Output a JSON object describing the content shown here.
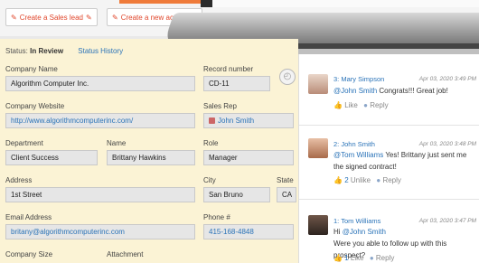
{
  "toolbar": {
    "create_lead": "Create a Sales lead",
    "create_activity": "Create a new activity"
  },
  "status": {
    "label": "Status:",
    "value": "In Review",
    "history": "Status History"
  },
  "form": {
    "company_name_label": "Company Name",
    "company_name": "Algorithm Computer Inc.",
    "record_number_label": "Record number",
    "record_number": "CD-11",
    "company_website_label": "Company Website",
    "company_website": "http://www.algorithmcomputerinc.com/",
    "sales_rep_label": "Sales Rep",
    "sales_rep": "John Smith",
    "department_label": "Department",
    "department": "Client Success",
    "name_label": "Name",
    "name": "Brittany Hawkins",
    "role_label": "Role",
    "role": "Manager",
    "address_label": "Address",
    "address": "1st Street",
    "city_label": "City",
    "city": "San Bruno",
    "state_label": "State",
    "state": "CA",
    "email_label": "Email Address",
    "email": "britany@algorithmcomputerinc.com",
    "phone_label": "Phone #",
    "phone": "415-168-4848",
    "company_size_label": "Company Size",
    "attachment_label": "Attachment"
  },
  "comments": [
    {
      "num": "3:",
      "author": "Mary Simpson",
      "date": "Apr 03, 2020 3:49 PM",
      "mention": "@John Smith",
      "text": " Congrats!!! Great job!",
      "like": "Like",
      "reply": "Reply"
    },
    {
      "num": "2:",
      "author": "John Smith",
      "date": "Apr 03, 2020 3:48 PM",
      "mention": "@Tom Williams",
      "text": " Yes! Brittany just sent me the signed contract!",
      "likes": "2",
      "unlike": "Unlike",
      "reply": "Reply"
    },
    {
      "num": "1:",
      "author": "Tom Williams",
      "date": "Apr 03, 2020 3:47 PM",
      "mention": "@John Smith",
      "text_line2": "Were you able to follow up with this prospect?",
      "prefix": "Hi ",
      "likes": "1",
      "like": "Like",
      "reply": "Reply"
    }
  ],
  "colors": {
    "accent": "#e0452a",
    "link": "#2a73b8",
    "form_bg": "#fbf3d5"
  }
}
